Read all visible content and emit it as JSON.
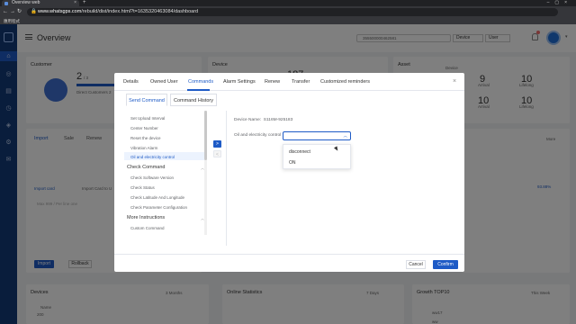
{
  "browser": {
    "tab_title": "Overview web",
    "new_tab": "+",
    "url_host": "www.whatsgps.com",
    "url_path": "/rebuild/dist/index.html?t=1635320463084/dashboard",
    "bookmark": "應用程式"
  },
  "topbar": {
    "page_title": "Overview",
    "search_value": "355500000462581",
    "device_select": "Device",
    "user_select": "User"
  },
  "background": {
    "customer_title": "Customer",
    "customer_count": "2",
    "customer_count_total": "/ 3",
    "direct_customers": "Direct Customers 2",
    "device_title": "Device",
    "device_partial": "187",
    "asset_title": "Asset",
    "asset_legend": "Device",
    "asset_arrival": "Arrival",
    "asset_lifelong": "Lifelong",
    "asset_arrival_value": "9",
    "asset_lifelong_value": "10",
    "asset_arrival_value_2": "10",
    "asset_lifelong_value_2": "10",
    "import_tabs": [
      "Import",
      "Sale",
      "Renew"
    ],
    "import_card": "Import card",
    "import_to_user": "Import Card to U",
    "import_btn": "Import",
    "rollback_btn": "Rollback",
    "textarea_placeholder": "Max 999 / Per line one",
    "more": "More",
    "percent": "93.88%",
    "devices_title": "Devices",
    "devices_period": "3 Months",
    "online_title": "Online Statistics",
    "online_period": "7 Days",
    "growth_title": "Growth TOP10",
    "growth_period": "This Week",
    "growth_item": "ww17",
    "growth_item_2": "ww",
    "chart_tick": "200",
    "chart_tick_label": "Name"
  },
  "modal": {
    "tabs": [
      "Details",
      "Owned User",
      "Commands",
      "Alarm Settings",
      "Renew",
      "Transfer",
      "Customized reminders"
    ],
    "close": "×",
    "subtabs": [
      "Send Command",
      "Command History"
    ],
    "commands": [
      {
        "label": "Set Upload Interval",
        "type": "item"
      },
      {
        "label": "Center Number",
        "type": "item"
      },
      {
        "label": "Reset the device",
        "type": "item"
      },
      {
        "label": "Vibration Alarm",
        "type": "item"
      },
      {
        "label": "Oil and electricity control",
        "type": "item",
        "active": true
      },
      {
        "label": "Check Command",
        "type": "group"
      },
      {
        "label": "Check Software Version",
        "type": "item"
      },
      {
        "label": "Check Status",
        "type": "item"
      },
      {
        "label": "Check Latitude And Longitude",
        "type": "item"
      },
      {
        "label": "Check Parameter Configuration",
        "type": "item"
      },
      {
        "label": "More Instructions",
        "type": "group"
      },
      {
        "label": "Custom Command",
        "type": "item"
      }
    ],
    "arrow_right": ">",
    "arrow_left": "<",
    "device_name_label": "Device Name",
    "device_name_value": "S116M-925183",
    "field_label": "Oil and electricity control",
    "select_value": "",
    "options": [
      "disconnect",
      "ON"
    ],
    "cancel": "Cancel",
    "confirm": "Confirm"
  },
  "colors": {
    "primary": "#1e5bc6",
    "sidebar": "#123a78"
  }
}
